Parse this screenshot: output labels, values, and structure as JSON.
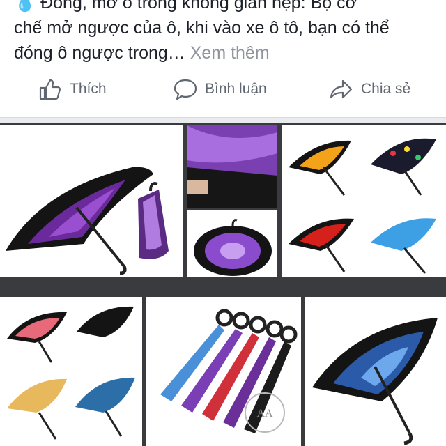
{
  "post": {
    "lead_icon": "water-drop-icon",
    "line1": "Đóng, mở ô trong không gian hẹp: Bộ cơ",
    "line2": "chế mở ngược của ô, khi vào xe ô tô, bạn có thể",
    "line3": "đóng ô ngược trong…",
    "see_more": "Xem thêm"
  },
  "actions": {
    "like": {
      "label": "Thích",
      "icon": "thumbs-up-icon"
    },
    "comment": {
      "label": "Bình luận",
      "icon": "speech-bubble-icon"
    },
    "share": {
      "label": "Chia sẻ",
      "icon": "share-arrow-icon"
    }
  },
  "gallery": {
    "watermark": "AA"
  },
  "colors": {
    "text": "#1d2129",
    "muted": "#90949c",
    "action": "#606770",
    "accent": "#1877f2"
  }
}
